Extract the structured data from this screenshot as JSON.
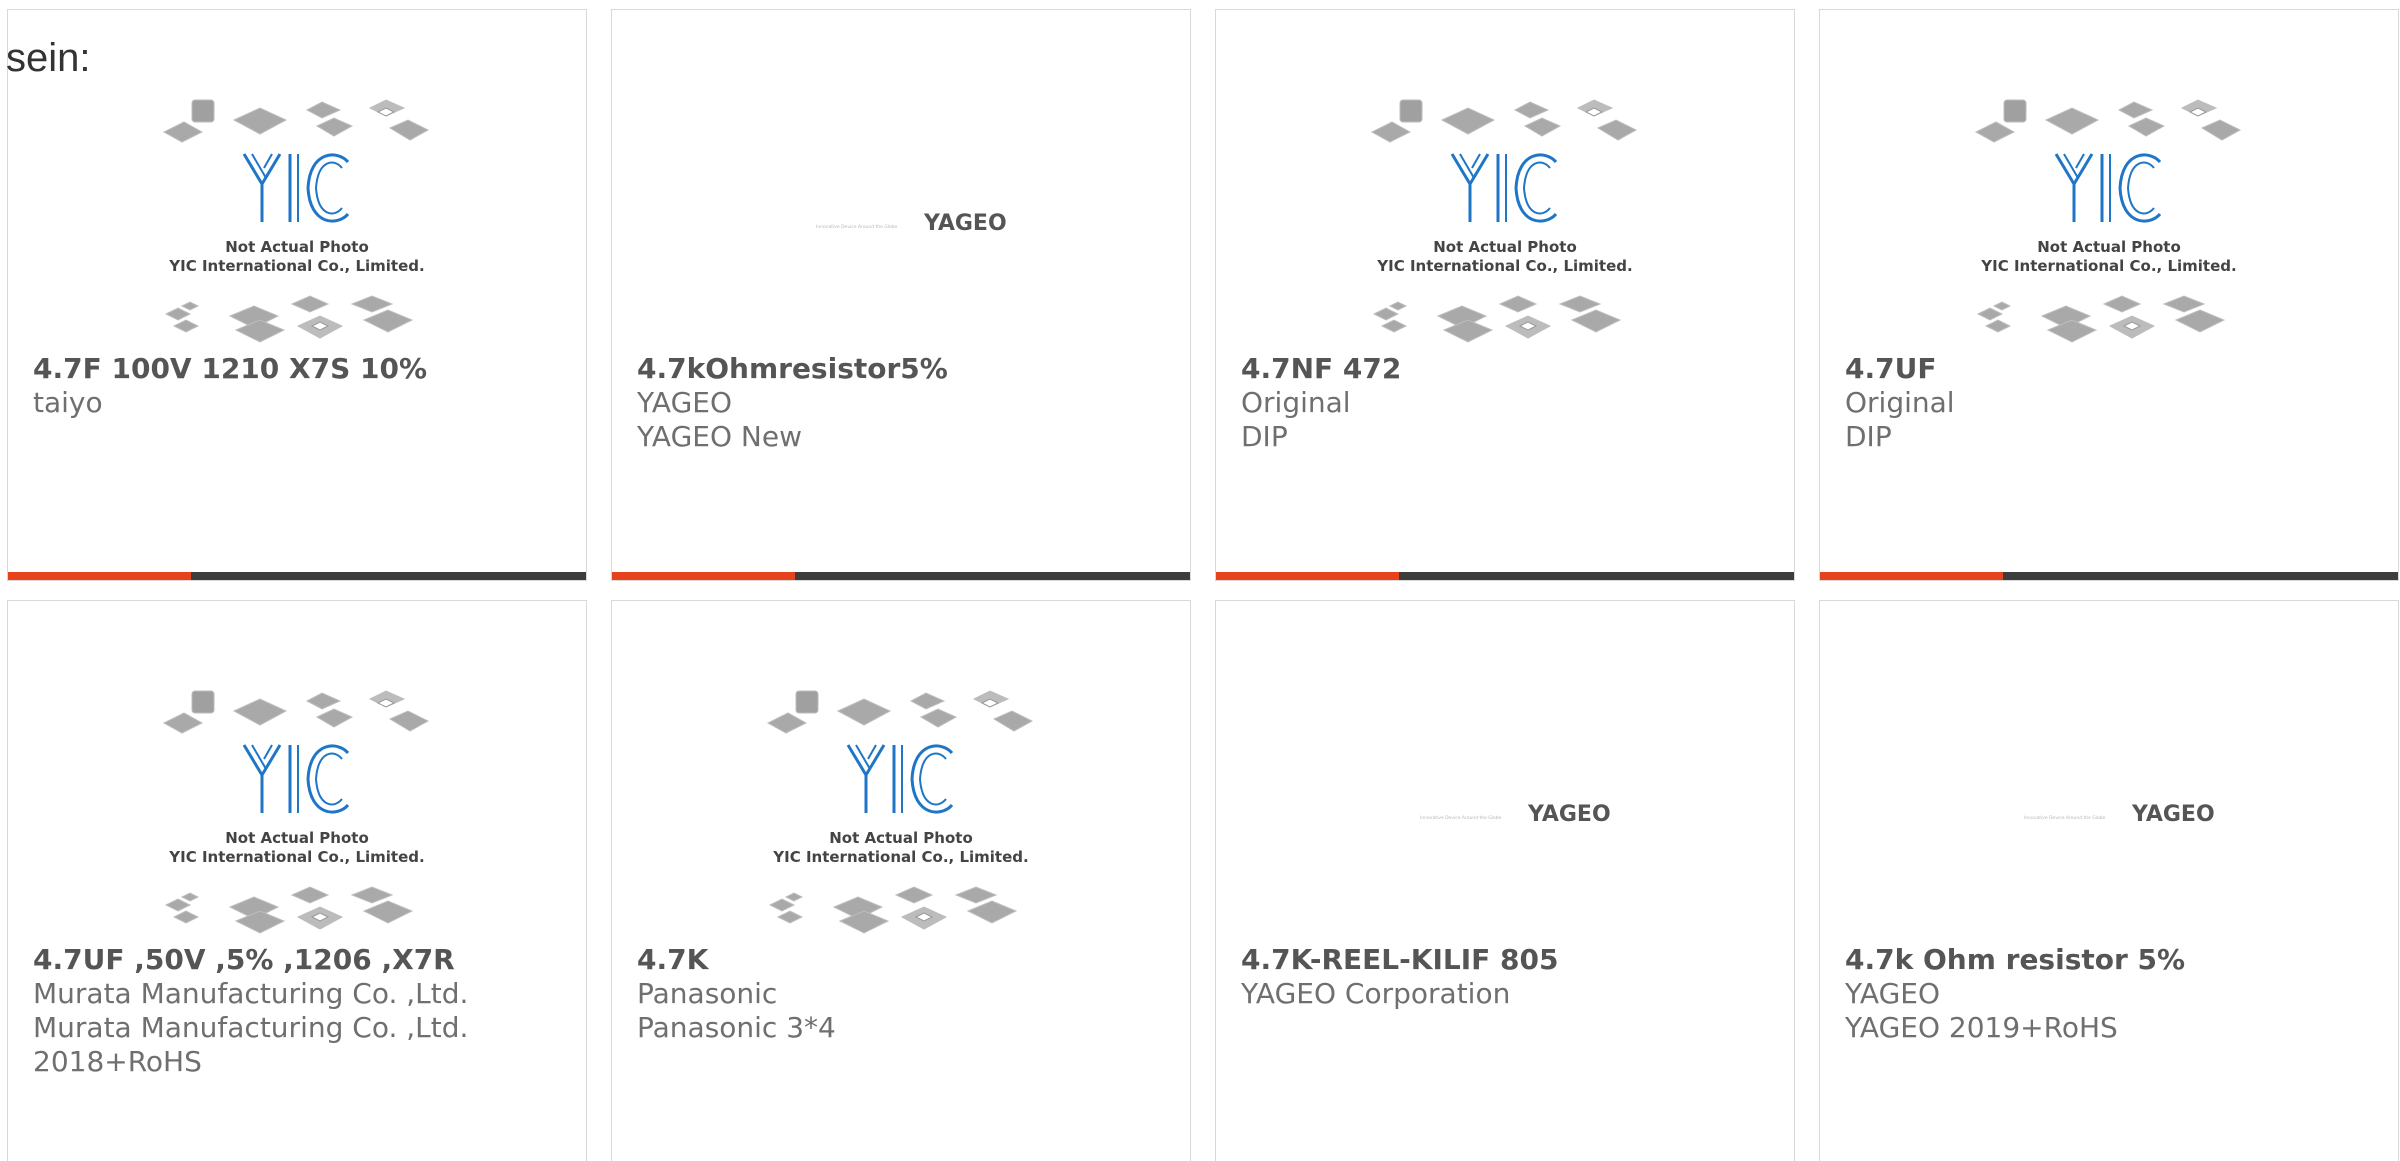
{
  "page": {
    "prefix_text": "sein:"
  },
  "placeholder_yic": {
    "line1": "Not Actual Photo",
    "line2": "YIC International Co., Limited."
  },
  "placeholder_yageo": {
    "tagline": "Innovative Device Around the Globe",
    "brand": "YAGEO"
  },
  "colors": {
    "accent": "#e8421d",
    "bar_dark": "#3d3d3d",
    "text": "#666666",
    "card_border": "#d9d9d9",
    "yic_blue": "#1f76c7"
  },
  "products": [
    {
      "image": "yic-placeholder-icon",
      "title": "4.7F 100V 1210 X7S 10%",
      "lines": [
        "taiyo"
      ],
      "accent_bar": true
    },
    {
      "image": "yageo-logo-icon",
      "title": "4.7kOhmresistor5%",
      "lines": [
        "YAGEO",
        "YAGEO New"
      ],
      "accent_bar": true
    },
    {
      "image": "yic-placeholder-icon",
      "title": "4.7NF 472",
      "lines": [
        "Original",
        "DIP"
      ],
      "accent_bar": true
    },
    {
      "image": "yic-placeholder-icon",
      "title": "4.7UF",
      "lines": [
        "Original",
        "DIP"
      ],
      "accent_bar": true
    },
    {
      "image": "yic-placeholder-icon",
      "title": "4.7UF ,50V ,5% ,1206 ,X7R",
      "lines": [
        "Murata Manufacturing Co. ,Ltd.",
        "Murata Manufacturing Co. ,Ltd.",
        "2018+RoHS"
      ],
      "accent_bar": false
    },
    {
      "image": "yic-placeholder-icon",
      "title": "4.7K",
      "lines": [
        "Panasonic",
        "Panasonic 3*4"
      ],
      "accent_bar": false
    },
    {
      "image": "yageo-logo-icon",
      "title": "4.7K-REEL-KILIF 805",
      "lines": [
        "YAGEO Corporation"
      ],
      "accent_bar": false
    },
    {
      "image": "yageo-logo-icon",
      "title": "4.7k Ohm resistor 5%",
      "lines": [
        "YAGEO",
        "YAGEO 2019+RoHS"
      ],
      "accent_bar": false
    }
  ]
}
